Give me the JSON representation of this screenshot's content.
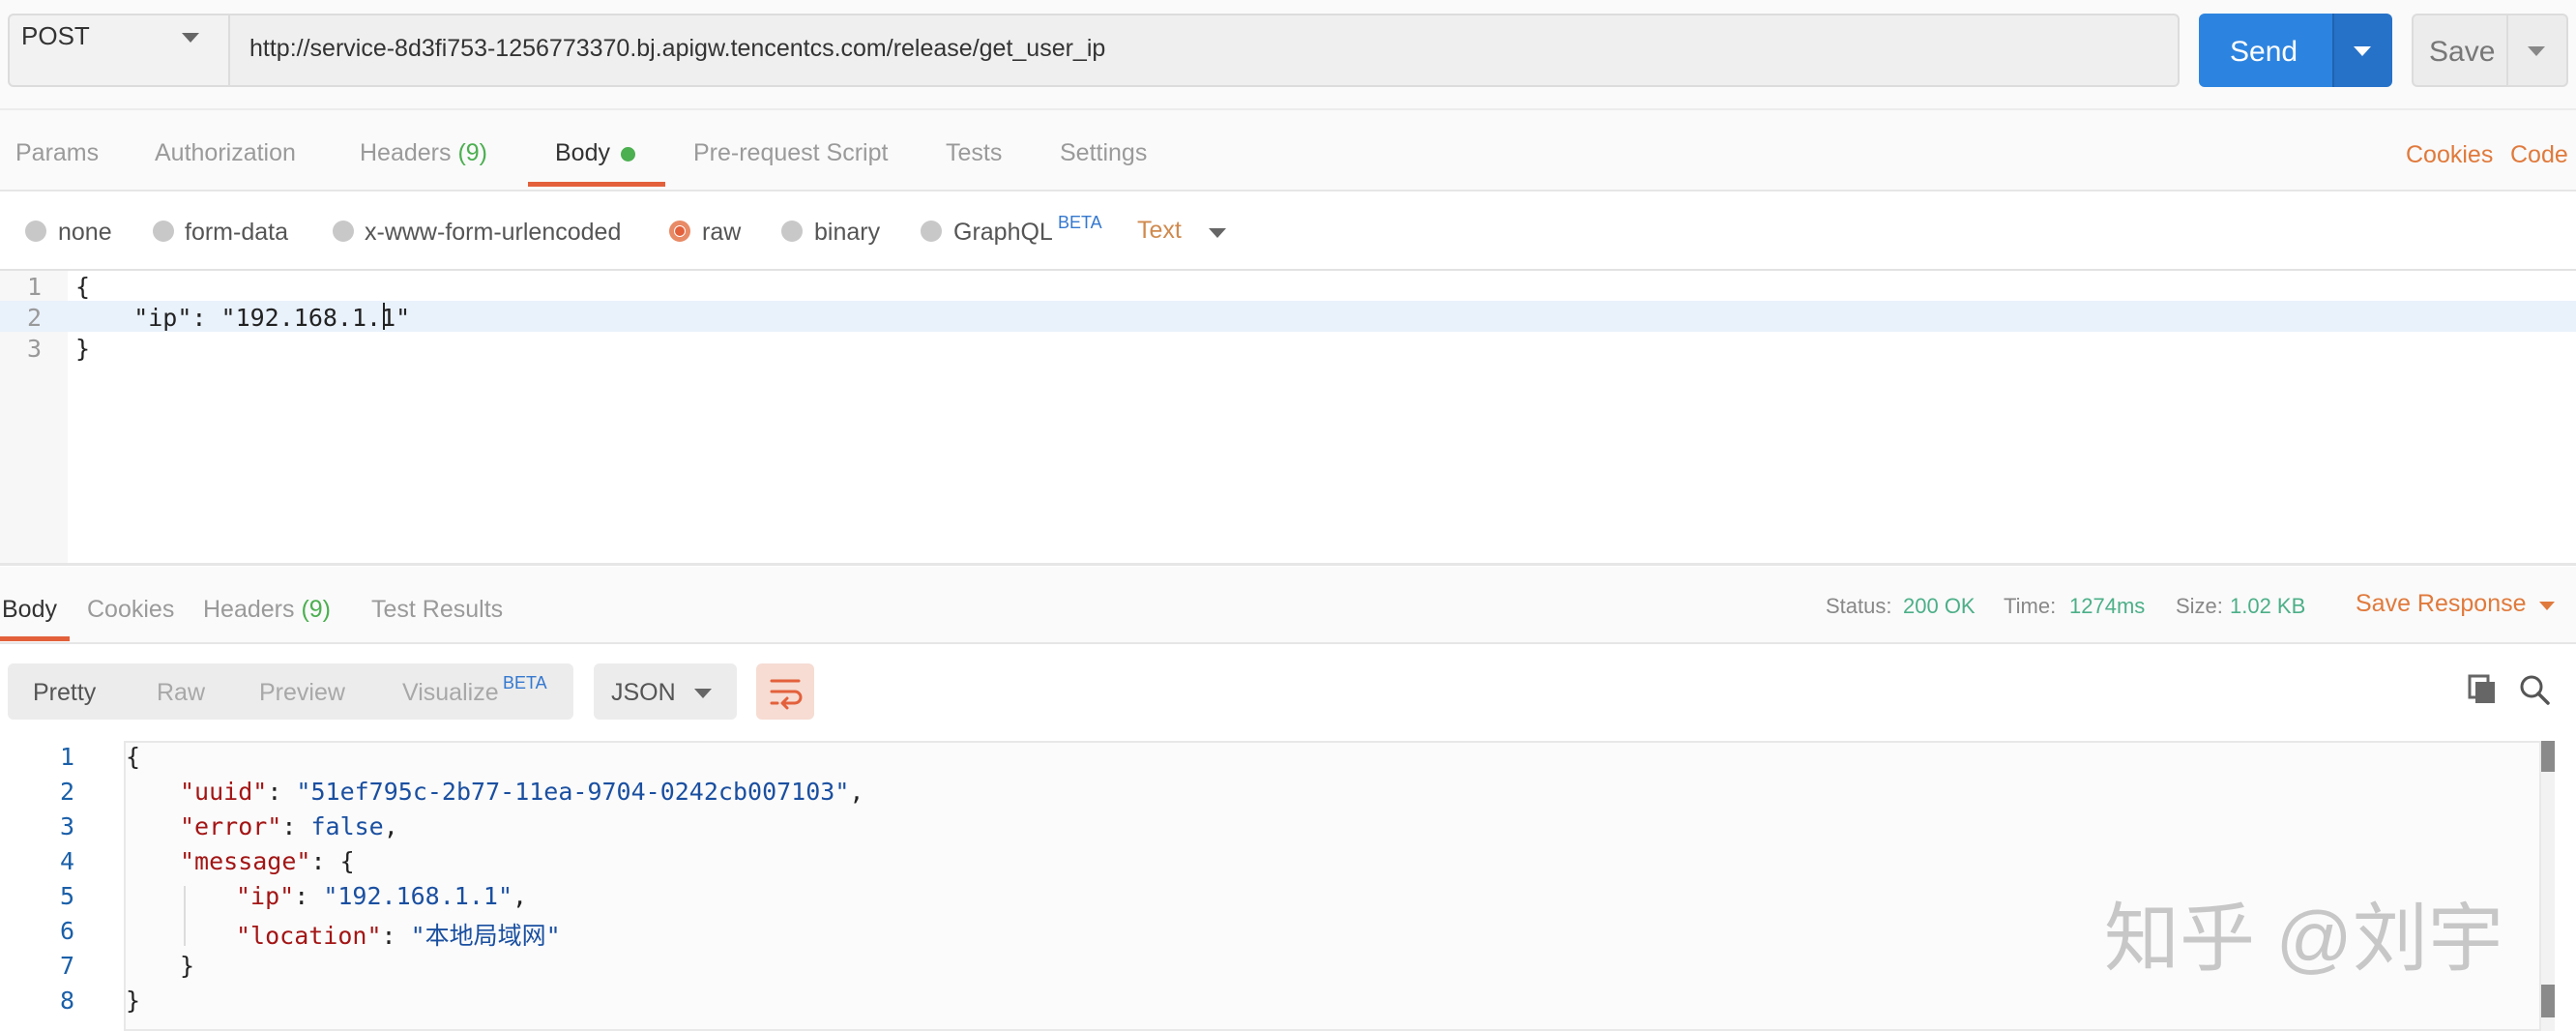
{
  "request": {
    "method": "POST",
    "url": "http://service-8d3fi753-1256773370.bj.apigw.tencentcs.com/release/get_user_ip",
    "send_label": "Send",
    "save_label": "Save"
  },
  "request_tabs": {
    "params": "Params",
    "authorization": "Authorization",
    "headers": "Headers",
    "headers_count": "(9)",
    "body": "Body",
    "prerequest": "Pre-request Script",
    "tests": "Tests",
    "settings": "Settings",
    "cookies": "Cookies",
    "code": "Code",
    "active": "Body"
  },
  "body_options": {
    "none": "none",
    "form_data": "form-data",
    "urlencoded": "x-www-form-urlencoded",
    "raw": "raw",
    "binary": "binary",
    "graphql": "GraphQL",
    "graphql_badge": "BETA",
    "selected": "raw",
    "format": "Text"
  },
  "request_body": {
    "line_numbers": [
      "1",
      "2",
      "3"
    ],
    "lines": [
      "{",
      "    \"ip\": \"192.168.1.1\"",
      "}"
    ]
  },
  "response_tabs": {
    "body": "Body",
    "cookies": "Cookies",
    "headers": "Headers",
    "headers_count": "(9)",
    "test_results": "Test Results"
  },
  "response_status": {
    "status_label": "Status:",
    "status_value": "200 OK",
    "time_label": "Time:",
    "time_value": "1274ms",
    "size_label": "Size:",
    "size_value": "1.02 KB",
    "save_response": "Save Response"
  },
  "response_view": {
    "pretty": "Pretty",
    "raw": "Raw",
    "preview": "Preview",
    "visualize": "Visualize",
    "visualize_badge": "BETA",
    "format": "JSON"
  },
  "response_body": {
    "line_numbers": [
      "1",
      "2",
      "3",
      "4",
      "5",
      "6",
      "7",
      "8"
    ],
    "l1": "{",
    "uuid_key": "\"uuid\"",
    "uuid_val": "\"51ef795c-2b77-11ea-9704-0242cb007103\"",
    "error_key": "\"error\"",
    "error_val": "false",
    "message_key": "\"message\"",
    "ip_key": "\"ip\"",
    "ip_val": "\"192.168.1.1\"",
    "location_key": "\"location\"",
    "location_val": "\"本地局域网\"",
    "l7": "}",
    "l8": "}"
  },
  "watermark": "知乎 @刘宇",
  "icons": {
    "method_dropdown": "chevron-down-icon",
    "send_dropdown": "chevron-down-icon",
    "save_dropdown": "chevron-down-icon",
    "wrap": "wrap-lines-icon",
    "copy": "copy-icon",
    "search": "search-icon"
  },
  "colors": {
    "accent_orange": "#e3603b",
    "send_blue": "#2d84e0",
    "status_green": "#4caf88"
  }
}
